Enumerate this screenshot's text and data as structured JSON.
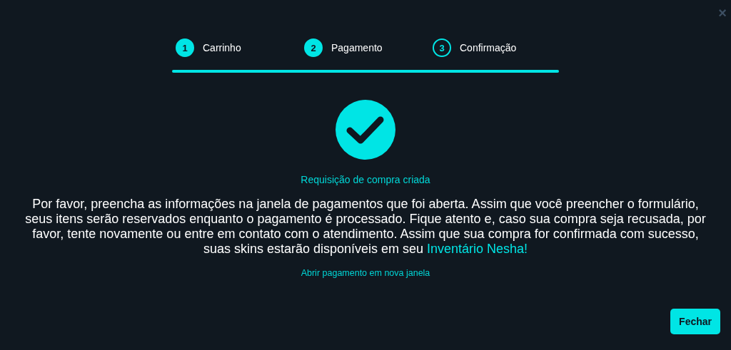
{
  "close_icon": "×",
  "steps": [
    {
      "number": "1",
      "label": "Carrinho",
      "done": true
    },
    {
      "number": "2",
      "label": "Pagamento",
      "done": true
    },
    {
      "number": "3",
      "label": "Confirmação",
      "done": false
    }
  ],
  "progress": {
    "level": 1
  },
  "status": {
    "title": "Requisição de compra criada",
    "message": "Por favor, preencha as informações na janela de pagamentos que foi aberta. Assim que você preencher o formulário, seus itens serão reservados enquanto o pagamento é processado. Fique atento e, caso sua compra seja recusada, por favor, tente novamente ou entre em contato com o atendimento. Assim que sua compra for confirmada com sucesso, suas skins estarão disponíveis em seu",
    "link": "Inventário Nesha!",
    "open_link": "Abrir pagamento em nova janela"
  },
  "buttons": [
    "Fechar"
  ]
}
